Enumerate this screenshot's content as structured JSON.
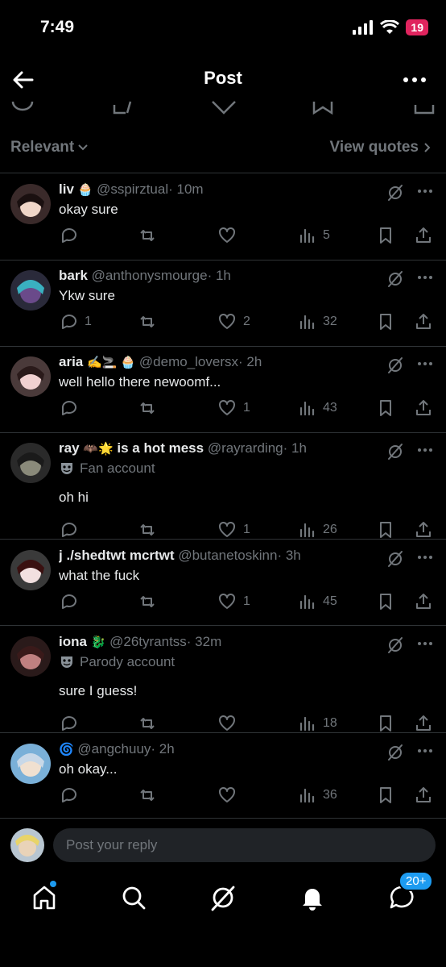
{
  "status": {
    "time": "7:49",
    "battery": "19"
  },
  "header": {
    "title": "Post"
  },
  "filter": {
    "sort_label": "Relevant",
    "quotes_label": "View quotes"
  },
  "replies": [
    {
      "name": "liv",
      "emoji": "🧁",
      "handle": "@sspirztual",
      "time": "· 10m",
      "badge": "",
      "text": "okay sure",
      "reply_count": "",
      "repost_count": "",
      "like_count": "",
      "views": "5"
    },
    {
      "name": "bark",
      "emoji": "",
      "handle": "@anthonysmourge",
      "time": "· 1h",
      "badge": "",
      "text": "Ykw sure",
      "reply_count": "1",
      "repost_count": "",
      "like_count": "2",
      "views": "32"
    },
    {
      "name": "aria",
      "emoji": "✍️🚬 🧁",
      "handle": "@demo_loversx",
      "time": "· 2h",
      "badge": "",
      "text": "well hello there newoomf...",
      "reply_count": "",
      "repost_count": "",
      "like_count": "1",
      "views": "43"
    },
    {
      "name": "ray",
      "emoji": "🦇🌟",
      "name_suffix": "is a hot mess",
      "handle": "@rayrarding",
      "time": "· 1h",
      "badge": "Fan account",
      "text": "oh hi",
      "reply_count": "",
      "repost_count": "",
      "like_count": "1",
      "views": "26"
    },
    {
      "name": "j ./shedtwt mcrtwt",
      "emoji": "",
      "handle": "@butanetoskinn",
      "time": "· 3h",
      "badge": "",
      "text": "what the fuck",
      "reply_count": "",
      "repost_count": "",
      "like_count": "1",
      "views": "45"
    },
    {
      "name": "iona",
      "emoji": "🐉",
      "handle": "@26tyrantss",
      "time": "· 32m",
      "badge": "Parody account",
      "text": "sure I guess!",
      "reply_count": "",
      "repost_count": "",
      "like_count": "",
      "views": "18"
    },
    {
      "name": "",
      "emoji": "🌀",
      "handle": "@angchuuy",
      "time": "· 2h",
      "badge": "",
      "text": "oh okay...",
      "reply_count": "",
      "repost_count": "",
      "like_count": "",
      "views": "36"
    }
  ],
  "compose": {
    "placeholder": "Post your reply"
  },
  "nav": {
    "notif_badge": "20+"
  },
  "icons": [
    "back-icon",
    "more-icon",
    "reply-icon",
    "repost-icon",
    "like-icon",
    "views-icon",
    "bookmark-icon",
    "share-icon",
    "grok-icon",
    "home-icon",
    "search-icon",
    "bell-icon",
    "messages-icon"
  ],
  "colors": {
    "background": "#000000",
    "text": "#e7e9ea",
    "muted": "#71767b",
    "accent": "#1d9bf0",
    "battery": "#e0245e"
  }
}
